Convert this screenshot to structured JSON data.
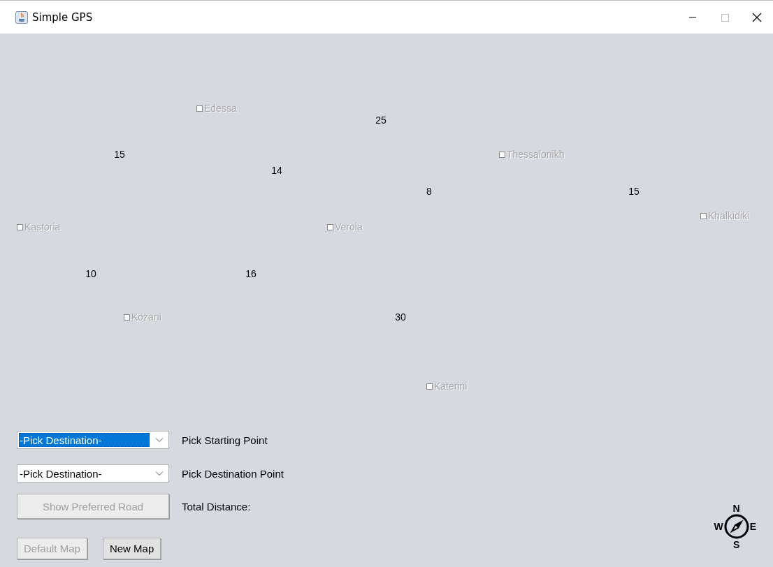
{
  "window": {
    "title": "Simple GPS"
  },
  "map": {
    "cities": [
      {
        "name": "Edessa",
        "checked": false,
        "disabled": true
      },
      {
        "name": "Thessalonikh",
        "checked": false,
        "disabled": true
      },
      {
        "name": "Kastoria",
        "checked": false,
        "disabled": true
      },
      {
        "name": "Veroia",
        "checked": false,
        "disabled": true
      },
      {
        "name": "Khalkidiki",
        "checked": false,
        "disabled": true
      },
      {
        "name": "Kozani",
        "checked": false,
        "disabled": true
      },
      {
        "name": "Katerini",
        "checked": false,
        "disabled": true
      }
    ],
    "distances": [
      "25",
      "15",
      "14",
      "8",
      "15",
      "10",
      "16",
      "30"
    ]
  },
  "controls": {
    "starting_point": {
      "value": "-Pick Destination-",
      "focused": true,
      "label": "Pick Starting Point"
    },
    "destination_point": {
      "value": "-Pick Destination-",
      "focused": false,
      "label": "Pick Destination Point"
    },
    "show_road_button": {
      "label": "Show Preferred Road",
      "disabled": true
    },
    "total_distance_label": "Total Distance:",
    "default_map_button": {
      "label": "Default Map",
      "disabled": true
    },
    "new_map_button": {
      "label": "New Map",
      "disabled": false
    }
  },
  "compass": {
    "north": "N",
    "west": "W",
    "east": "E",
    "south": "S"
  }
}
